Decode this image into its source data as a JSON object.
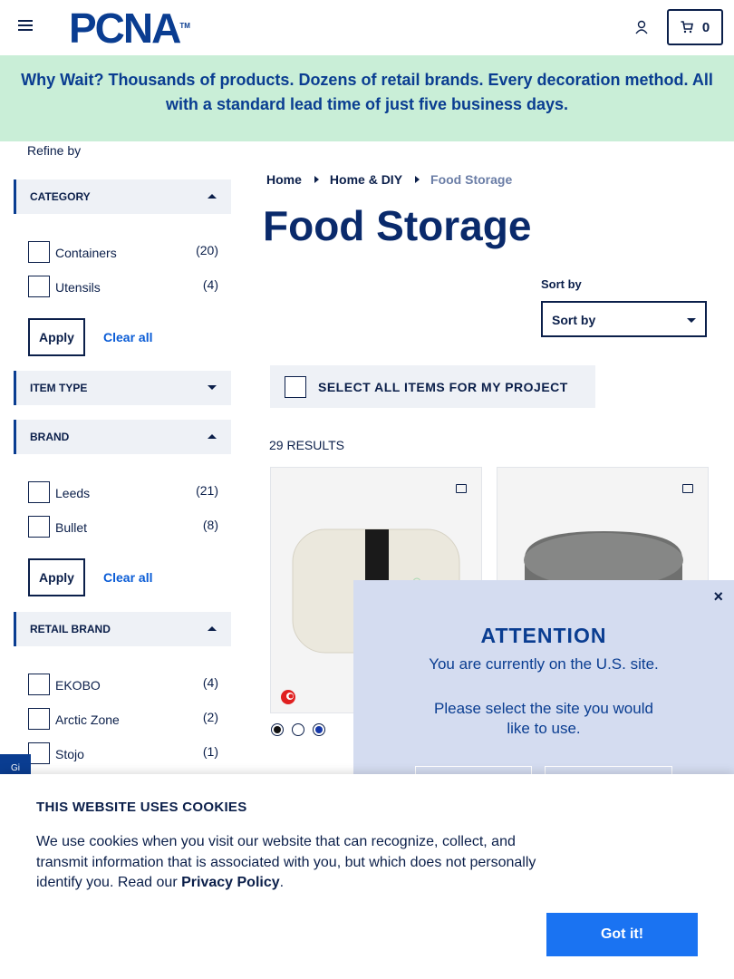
{
  "header": {
    "logo_text": "PCNA",
    "logo_tm": "TM",
    "cart_count": "0"
  },
  "banner": {
    "text": "Why Wait? Thousands of products. Dozens of retail brands. Every decoration method. All with a standard lead time of just five business days."
  },
  "sidebar": {
    "refine_label": "Refine by",
    "apply_label": "Apply",
    "clear_label": "Clear all",
    "facets": {
      "category": {
        "title": "CATEGORY",
        "expanded": true,
        "options": [
          {
            "label": "Containers",
            "count": "(20)"
          },
          {
            "label": "Utensils",
            "count": "(4)"
          }
        ]
      },
      "item_type": {
        "title": "ITEM TYPE",
        "expanded": false
      },
      "brand": {
        "title": "BRAND",
        "expanded": true,
        "options": [
          {
            "label": "Leeds",
            "count": "(21)"
          },
          {
            "label": "Bullet",
            "count": "(8)"
          }
        ]
      },
      "retail_brand": {
        "title": "RETAIL BRAND",
        "expanded": true,
        "options": [
          {
            "label": "EKOBO",
            "count": "(4)"
          },
          {
            "label": "Arctic Zone",
            "count": "(2)"
          },
          {
            "label": "Stojo",
            "count": "(1)"
          }
        ]
      }
    }
  },
  "main": {
    "breadcrumbs": [
      "Home",
      "Home & DIY",
      "Food Storage"
    ],
    "title": "Food Storage",
    "sort_label": "Sort by",
    "sort_value": "Sort by",
    "select_all_label": "SELECT ALL ITEMS FOR MY PROJECT",
    "results_count": "29 RESULTS",
    "products": [
      {
        "name": "bento-box",
        "swatches": [
          "#111111",
          "#ffffff",
          "#1638a8"
        ]
      },
      {
        "name": "round-container",
        "swatches": []
      }
    ]
  },
  "side_tab": {
    "text": "Gi"
  },
  "modal": {
    "title": "ATTENTION",
    "line1": "You are currently on the U.S. site.",
    "line2": "Please select the site you would",
    "line3": "like to use.",
    "close_symbol": "×"
  },
  "cookie": {
    "title": "THIS WEBSITE USES COOKIES",
    "body": "We use cookies when you visit our website that can recognize, collect, and transmit information that is associated with you, but which does not personally identify you. Read our",
    "link": "Privacy Policy",
    "period": ".",
    "button": "Got it!"
  },
  "colors": {
    "navy": "#0b1f4a",
    "brand_blue": "#0a3d91",
    "banner_green": "#c9eed7",
    "modal_bg": "#d4dcf0",
    "cookie_button": "#1a73f2"
  }
}
